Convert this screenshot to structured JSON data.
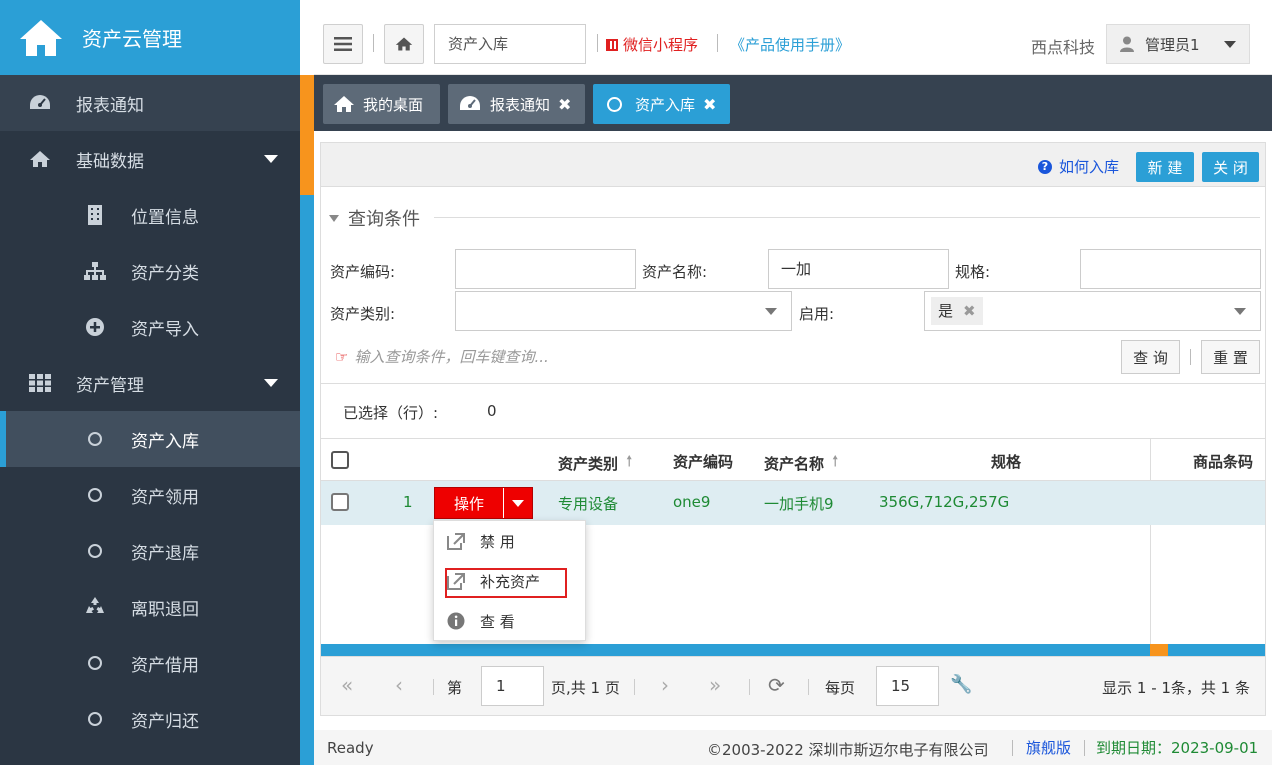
{
  "app": {
    "title": "资产云管理"
  },
  "sidebar": {
    "items": [
      {
        "label": "报表通知",
        "icon": "dashboard-icon"
      },
      {
        "label": "基础数据",
        "icon": "home-icon"
      },
      {
        "label": "位置信息",
        "icon": "building-icon"
      },
      {
        "label": "资产分类",
        "icon": "sitemap-icon"
      },
      {
        "label": "资产导入",
        "icon": "plus-circle-icon"
      },
      {
        "label": "资产管理",
        "icon": "grid-icon"
      },
      {
        "label": "资产入库",
        "icon": "circle-icon"
      },
      {
        "label": "资产领用",
        "icon": "circle-icon"
      },
      {
        "label": "资产退库",
        "icon": "circle-icon"
      },
      {
        "label": "离职退回",
        "icon": "recycle-icon"
      },
      {
        "label": "资产借用",
        "icon": "circle-icon"
      },
      {
        "label": "资产归还",
        "icon": "circle-icon"
      }
    ]
  },
  "topbar": {
    "current_page": "资产入库",
    "wechat": "微信小程序",
    "manual": "《产品使用手册》",
    "company": "西点科技",
    "user": "管理员1"
  },
  "tabs": [
    {
      "label": "我的桌面"
    },
    {
      "label": "报表通知"
    },
    {
      "label": "资产入库"
    }
  ],
  "panel": {
    "howto": "如何入库",
    "new_label": "新 建",
    "close_label": "关 闭",
    "query_title": "查询条件",
    "fields": {
      "code_label": "资产编码:",
      "code_value": "",
      "name_label": "资产名称:",
      "name_value": "一加",
      "spec_label": "规格:",
      "spec_value": "",
      "category_label": "资产类别:",
      "category_value": "",
      "enabled_label": "启用:",
      "enabled_tag": "是"
    },
    "hint": "输入查询条件，回车键查询...",
    "search_label": "查 询",
    "reset_label": "重 置",
    "selected_label": "已选择（行）:",
    "selected_count": "0"
  },
  "table": {
    "headers": [
      "资产类别",
      "资产编码",
      "资产名称",
      "规格",
      "商品条码"
    ],
    "rows": [
      {
        "num": "1",
        "category": "专用设备",
        "code": "one9",
        "name": "一加手机9",
        "spec": "356G,712G,257G",
        "barcode": ""
      }
    ],
    "op_label": "操作"
  },
  "dropdown": {
    "items": [
      {
        "label": "禁 用",
        "icon": "external-link-icon"
      },
      {
        "label": "补充资产",
        "icon": "external-link-icon"
      },
      {
        "label": "查 看",
        "icon": "info-icon"
      }
    ]
  },
  "pager": {
    "page_prefix": "第",
    "page_value": "1",
    "page_suffix": "页,共 1 页",
    "per_page_label": "每页",
    "per_page_value": "15",
    "summary": "显示 1 - 1条，共 1 条"
  },
  "footer": {
    "status": "Ready",
    "copyright": "©2003-2022 深圳市斯迈尔电子有限公司",
    "edition": "旗舰版",
    "expire": "到期日期：2023-09-01"
  },
  "colors": {
    "primary": "#2b9fd6",
    "sidebar": "#2b3643",
    "danger": "#e00000",
    "success": "#1e8a34",
    "accent": "#f7941d"
  }
}
